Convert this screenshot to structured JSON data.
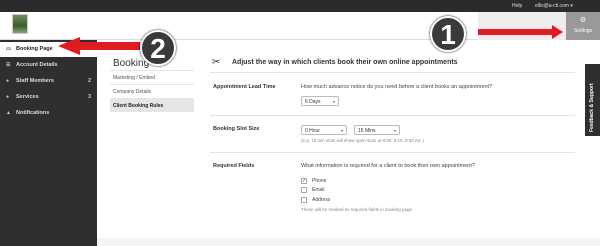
{
  "topbar": {
    "help": "Help",
    "user": "ellis@a-cti.com ▾"
  },
  "header": {
    "settings_label": "Settings",
    "settings_icon": "sliders-icon"
  },
  "sidebar": {
    "items": [
      {
        "label": "Booking Page",
        "icon": "monitor-icon",
        "count": ""
      },
      {
        "label": "Account Details",
        "icon": "list-icon",
        "count": ""
      },
      {
        "label": "Staff Members",
        "icon": "users-icon",
        "count": "2"
      },
      {
        "label": "Services",
        "icon": "circle-icon",
        "count": "3"
      },
      {
        "label": "Notifications",
        "icon": "bell-icon",
        "count": ""
      }
    ]
  },
  "subnav": {
    "title": "Booking",
    "items": [
      {
        "label": "Marketing / Embed"
      },
      {
        "label": "Company Details"
      },
      {
        "label": "Client Booking Rules"
      }
    ]
  },
  "main": {
    "title": "Adjust the way in which clients book their own online appointments",
    "lead_time": {
      "label": "Appointment Lead Time",
      "question": "How much advance notice do you need before a client books an appointment?",
      "value": "6 Days"
    },
    "slot_size": {
      "label": "Booking Slot Size",
      "hours": "0 Hour",
      "mins": "15 Mins",
      "hint": "(e.g. 15 min slots will show open slots at 8:00, 8:15, 8:30 etc.)"
    },
    "required": {
      "label": "Required Fields",
      "question": "What information is required for a client to book their own appointment?",
      "options": [
        {
          "label": "Phone",
          "checked": true
        },
        {
          "label": "Email",
          "checked": false
        },
        {
          "label": "Address",
          "checked": false
        }
      ],
      "note": "These will be marked as required fields in booking page."
    }
  },
  "feedback": {
    "label": "Feedback & Support"
  },
  "annotations": {
    "badge_1": "1",
    "badge_2": "2",
    "arrow_color": "#e11b22"
  }
}
